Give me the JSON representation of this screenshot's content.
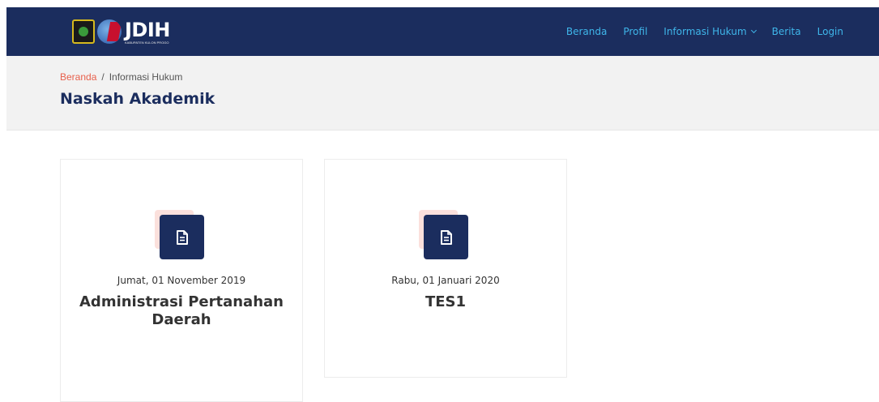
{
  "brand": {
    "title": "JDIH",
    "subtitle": "KABUPATEN KULON PROGO"
  },
  "nav": {
    "items": [
      {
        "label": "Beranda"
      },
      {
        "label": "Profil"
      },
      {
        "label": "Informasi Hukum",
        "dropdown": true
      },
      {
        "label": "Berita"
      },
      {
        "label": "Login"
      }
    ],
    "link_color": "#3fb6ea",
    "bg_color": "#1b2d5e"
  },
  "breadcrumb": {
    "home": "Beranda",
    "separator": "/",
    "current": "Informasi Hukum"
  },
  "page_title": "Naskah Akademik",
  "cards": [
    {
      "date": "Jumat, 01 November 2019",
      "title": "Administrasi Pertanahan Daerah",
      "icon": "document-icon"
    },
    {
      "date": "Rabu, 01 Januari 2020",
      "title": "TES1",
      "icon": "document-icon"
    }
  ],
  "colors": {
    "accent": "#e8604c",
    "navy": "#1b2d5e",
    "icon_bg": "#fbe0dc"
  }
}
